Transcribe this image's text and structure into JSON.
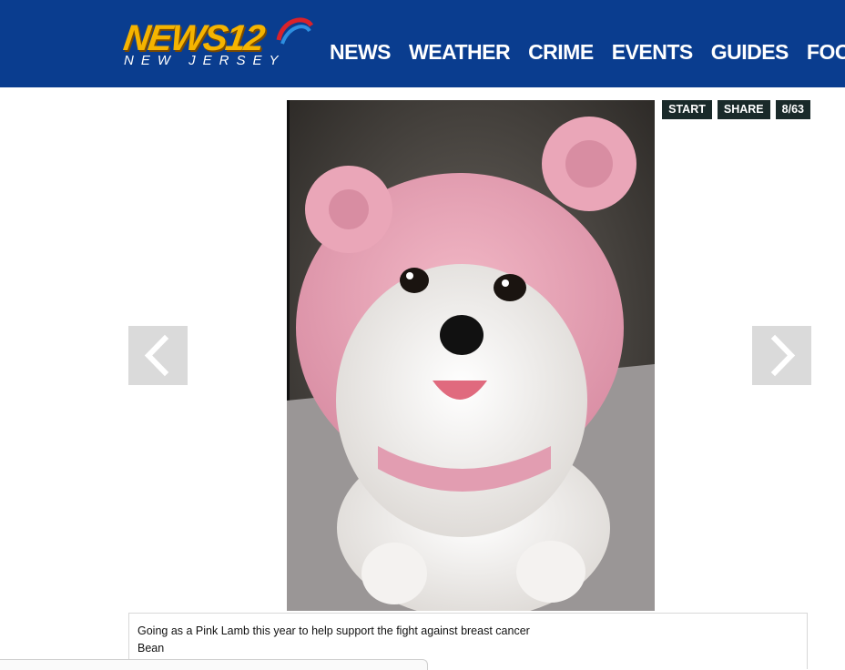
{
  "header": {
    "logo_word": "NEWS12",
    "logo_sub": "NEW JERSEY",
    "nav": [
      "NEWS",
      "WEATHER",
      "CRIME",
      "EVENTS",
      "GUIDES",
      "FOOD &"
    ]
  },
  "gallery": {
    "controls": {
      "start": "START",
      "share": "SHARE",
      "counter": "8/63"
    },
    "caption_line1": "Going as a Pink Lamb this year to help support the fight against breast cancer",
    "caption_line2": "Bean"
  },
  "status_bar": {
    "text": ""
  },
  "colors": {
    "header_bg": "#0a3d8f",
    "logo_gold": "#f5b400",
    "control_bg": "#1a2a2a",
    "arrow_bg": "#dadada"
  },
  "icons": {
    "prev": "chevron-left-icon",
    "next": "chevron-right-icon"
  }
}
